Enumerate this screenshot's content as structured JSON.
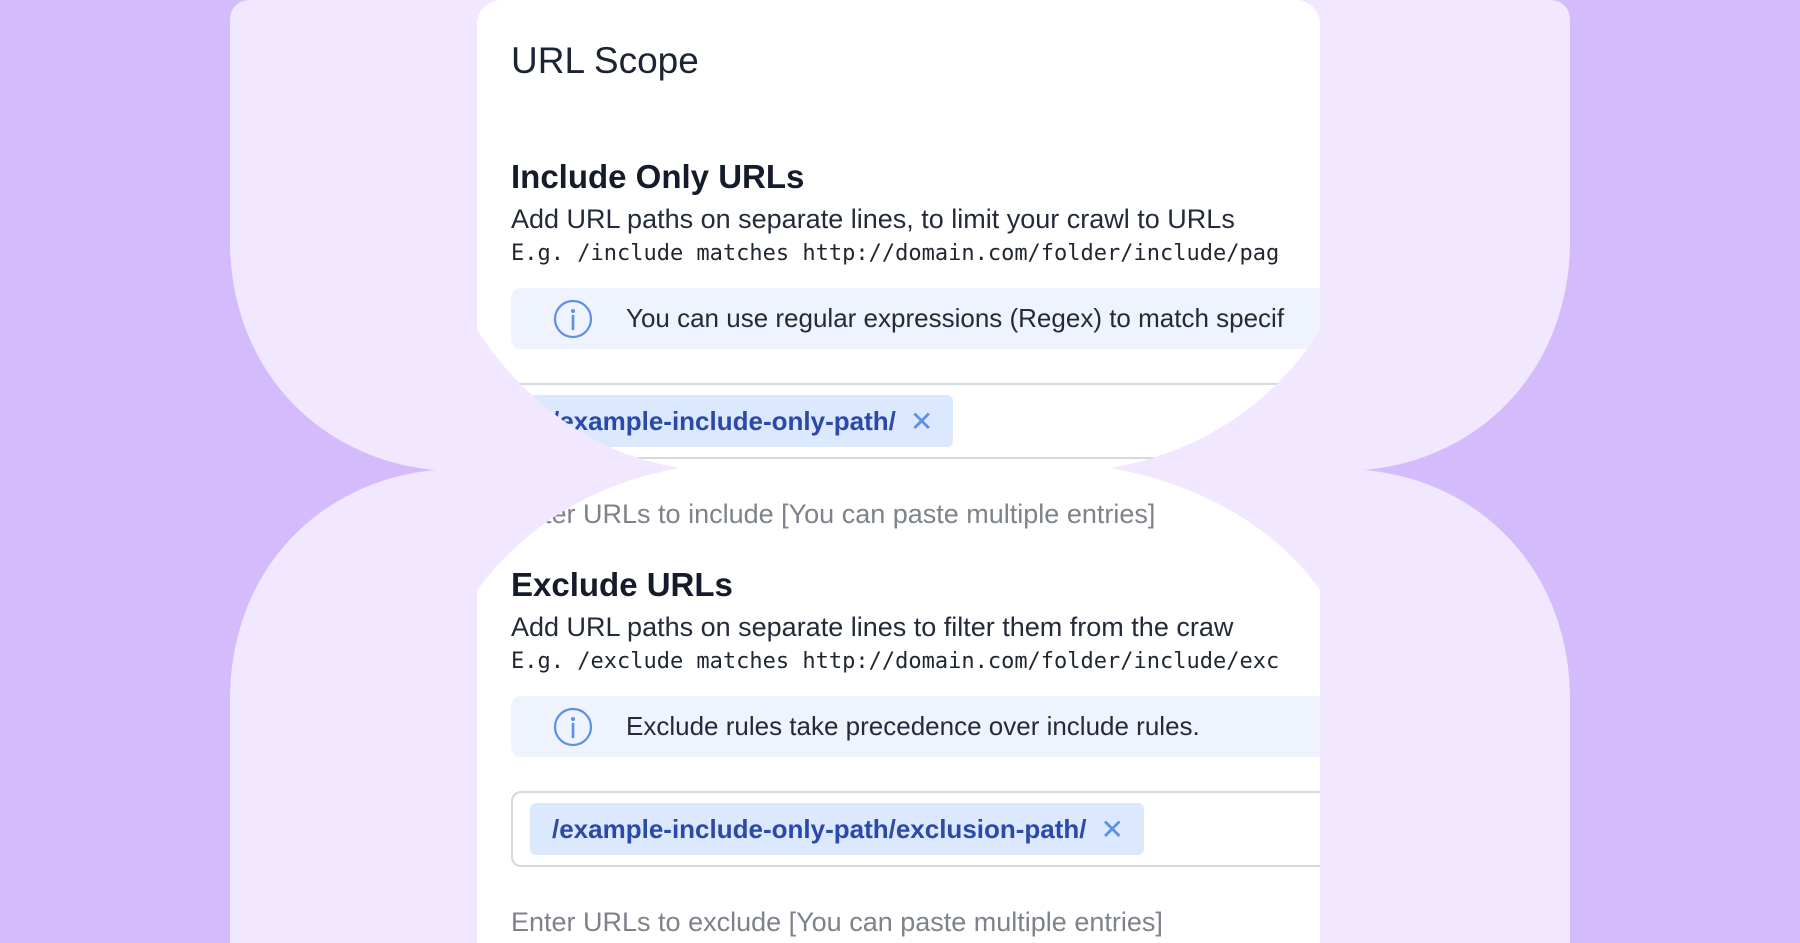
{
  "page_title": "URL Scope",
  "include": {
    "title": "Include Only URLs",
    "description": "Add URL paths on separate lines, to limit your crawl to URLs",
    "example": "E.g. /include matches http://domain.com/folder/include/pag",
    "info": "You can use regular expressions (Regex) to match specif",
    "tags": [
      "/example-include-only-path/"
    ],
    "placeholder": "Enter URLs to include [You can paste multiple entries]"
  },
  "exclude": {
    "title": "Exclude URLs",
    "description": "Add URL paths on separate lines to filter them from the craw",
    "example": "E.g. /exclude matches http://domain.com/folder/include/exc",
    "info": "Exclude rules take precedence over include rules.",
    "tags": [
      "/example-include-only-path/exclusion-path/"
    ],
    "placeholder": "Enter URLs to exclude [You can paste multiple entries]"
  },
  "icons": {
    "info": "info-circle-icon",
    "remove": "close-icon"
  },
  "colors": {
    "background": "#d4bcfc",
    "decorative_shape": "#f1e7fe",
    "panel": "#ffffff",
    "tag_background": "#dce8fd",
    "tag_text": "#2a49a8",
    "info_background": "#eef3fd",
    "info_icon": "#5d8ee8"
  }
}
